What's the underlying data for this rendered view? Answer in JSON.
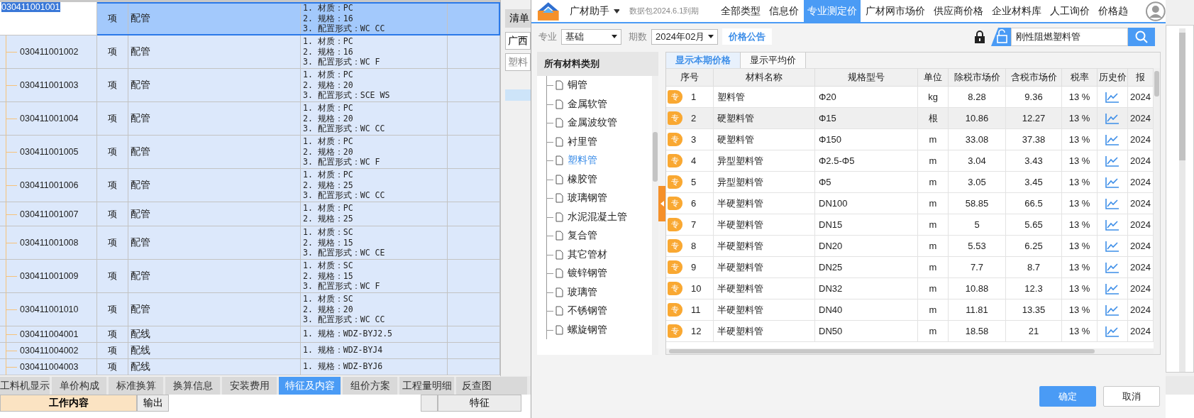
{
  "bill_table": {
    "rows": [
      {
        "code": "030411001001",
        "unit": "项",
        "name": "配管",
        "features": [
          "1. 材质：PC",
          "2. 规格：16",
          "3. 配置形式：WC CC"
        ],
        "selected": true
      },
      {
        "code": "030411001002",
        "unit": "项",
        "name": "配管",
        "features": [
          "1. 材质：PC",
          "2. 规格：16",
          "3. 配置形式：WC F"
        ],
        "selected": false
      },
      {
        "code": "030411001003",
        "unit": "项",
        "name": "配管",
        "features": [
          "1. 材质：PC",
          "2. 规格：20",
          "3. 配置形式：SCE WS"
        ],
        "selected": false
      },
      {
        "code": "030411001004",
        "unit": "项",
        "name": "配管",
        "features": [
          "1. 材质：PC",
          "2. 规格：20",
          "3. 配置形式：WC CC"
        ],
        "selected": false
      },
      {
        "code": "030411001005",
        "unit": "项",
        "name": "配管",
        "features": [
          "1. 材质：PC",
          "2. 规格：20",
          "3. 配置形式：WC F"
        ],
        "selected": false
      },
      {
        "code": "030411001006",
        "unit": "项",
        "name": "配管",
        "features": [
          "1. 材质：PC",
          "2. 规格：25",
          "3. 配置形式：WC CC"
        ],
        "selected": false
      },
      {
        "code": "030411001007",
        "unit": "项",
        "name": "配管",
        "features": [
          "1. 材质：PC",
          "2. 规格：25"
        ],
        "selected": false
      },
      {
        "code": "030411001008",
        "unit": "项",
        "name": "配管",
        "features": [
          "1. 材质：SC",
          "2. 规格：15",
          "3. 配置形式：WC CE"
        ],
        "selected": false
      },
      {
        "code": "030411001009",
        "unit": "项",
        "name": "配管",
        "features": [
          "1. 材质：SC",
          "2. 规格：15",
          "3. 配置形式：WC F"
        ],
        "selected": false
      },
      {
        "code": "030411001010",
        "unit": "项",
        "name": "配管",
        "features": [
          "1. 材质：SC",
          "2. 规格：20",
          "3. 配置形式：WC CC"
        ],
        "selected": false
      },
      {
        "code": "030411004001",
        "unit": "项",
        "name": "配线",
        "features": [
          "1. 规格：WDZ-BYJ2.5"
        ],
        "selected": false
      },
      {
        "code": "030411004002",
        "unit": "项",
        "name": "配线",
        "features": [
          "1. 规格：WDZ-BYJ4"
        ],
        "selected": false
      },
      {
        "code": "030411004003",
        "unit": "项",
        "name": "配线",
        "features": [
          "1. 规格：WDZ-BYJ6"
        ],
        "selected": false
      }
    ]
  },
  "bottom_tabs": [
    {
      "label": "工料机显示",
      "selected": false
    },
    {
      "label": "单价构成",
      "selected": false
    },
    {
      "label": "标准换算",
      "selected": false
    },
    {
      "label": "换算信息",
      "selected": false
    },
    {
      "label": "安装费用",
      "selected": false
    },
    {
      "label": "特征及内容",
      "selected": true
    },
    {
      "label": "组价方案",
      "selected": false
    },
    {
      "label": "工程量明细",
      "selected": false
    },
    {
      "label": "反查图",
      "selected": false
    }
  ],
  "work_content": {
    "columns": [
      "工作内容",
      "输出"
    ]
  },
  "feature_panel": {
    "columns": [
      "特征"
    ]
  },
  "background_dialog": {
    "title": "清单",
    "region_value": "广西",
    "search_value": "塑料"
  },
  "material_dialog": {
    "app_name": "广材助手",
    "package_note": "数据包2024.6.1到期",
    "nav": [
      {
        "label": "全部类型",
        "selected": false
      },
      {
        "label": "信息价",
        "selected": false
      },
      {
        "label": "专业测定价",
        "selected": true
      },
      {
        "label": "广材网市场价",
        "selected": false
      },
      {
        "label": "供应商价格",
        "selected": false
      },
      {
        "label": "企业材料库",
        "selected": false
      },
      {
        "label": "人工询价",
        "selected": false
      },
      {
        "label": "价格趋",
        "selected": false
      }
    ],
    "filters": {
      "specialty_label": "专业",
      "specialty": "基础",
      "period_label": "期数",
      "period": "2024年02月",
      "notice_button": "价格公告",
      "search_value": "刚性阻燃塑料管"
    },
    "categories": {
      "header": "所有材料类别",
      "items": [
        {
          "label": "铜管",
          "selected": false
        },
        {
          "label": "金属软管",
          "selected": false
        },
        {
          "label": "金属波纹管",
          "selected": false
        },
        {
          "label": "衬里管",
          "selected": false
        },
        {
          "label": "塑料管",
          "selected": true
        },
        {
          "label": "橡胶管",
          "selected": false
        },
        {
          "label": "玻璃钢管",
          "selected": false
        },
        {
          "label": "水泥混凝土管",
          "selected": false
        },
        {
          "label": "复合管",
          "selected": false
        },
        {
          "label": "其它管材",
          "selected": false
        },
        {
          "label": "镀锌钢管",
          "selected": false
        },
        {
          "label": "玻璃管",
          "selected": false
        },
        {
          "label": "不锈钢管",
          "selected": false
        },
        {
          "label": "螺旋钢管",
          "selected": false
        }
      ]
    },
    "view_tabs": [
      {
        "label": "显示本期价格",
        "selected": true
      },
      {
        "label": "显示平均价",
        "selected": false
      }
    ],
    "columns": [
      "序号",
      "材料名称",
      "规格型号",
      "单位",
      "除税市场价",
      "含税市场价",
      "税率",
      "历史价",
      "报"
    ],
    "rows": [
      {
        "badge": "专",
        "no": "1",
        "name": "塑料管",
        "spec": "Φ20",
        "unit": "kg",
        "price_ex_tax": "8.28",
        "price_inc_tax": "9.36",
        "tax_rate": "13 %",
        "quote": "2024",
        "selected": false
      },
      {
        "badge": "专",
        "no": "2",
        "name": "硬塑料管",
        "spec": "Φ15",
        "unit": "根",
        "price_ex_tax": "10.86",
        "price_inc_tax": "12.27",
        "tax_rate": "13 %",
        "quote": "2024",
        "selected": true
      },
      {
        "badge": "专",
        "no": "3",
        "name": "硬塑料管",
        "spec": "Φ150",
        "unit": "m",
        "price_ex_tax": "33.08",
        "price_inc_tax": "37.38",
        "tax_rate": "13 %",
        "quote": "2024",
        "selected": false
      },
      {
        "badge": "专",
        "no": "4",
        "name": "异型塑料管",
        "spec": "Φ2.5-Φ5",
        "unit": "m",
        "price_ex_tax": "3.04",
        "price_inc_tax": "3.43",
        "tax_rate": "13 %",
        "quote": "2024",
        "selected": false
      },
      {
        "badge": "专",
        "no": "5",
        "name": "异型塑料管",
        "spec": "Φ5",
        "unit": "m",
        "price_ex_tax": "3.05",
        "price_inc_tax": "3.45",
        "tax_rate": "13 %",
        "quote": "2024",
        "selected": false
      },
      {
        "badge": "专",
        "no": "6",
        "name": "半硬塑料管",
        "spec": "DN100",
        "unit": "m",
        "price_ex_tax": "58.85",
        "price_inc_tax": "66.5",
        "tax_rate": "13 %",
        "quote": "2024",
        "selected": false
      },
      {
        "badge": "专",
        "no": "7",
        "name": "半硬塑料管",
        "spec": "DN15",
        "unit": "m",
        "price_ex_tax": "5",
        "price_inc_tax": "5.65",
        "tax_rate": "13 %",
        "quote": "2024",
        "selected": false
      },
      {
        "badge": "专",
        "no": "8",
        "name": "半硬塑料管",
        "spec": "DN20",
        "unit": "m",
        "price_ex_tax": "5.53",
        "price_inc_tax": "6.25",
        "tax_rate": "13 %",
        "quote": "2024",
        "selected": false
      },
      {
        "badge": "专",
        "no": "9",
        "name": "半硬塑料管",
        "spec": "DN25",
        "unit": "m",
        "price_ex_tax": "7.7",
        "price_inc_tax": "8.7",
        "tax_rate": "13 %",
        "quote": "2024",
        "selected": false
      },
      {
        "badge": "专",
        "no": "10",
        "name": "半硬塑料管",
        "spec": "DN32",
        "unit": "m",
        "price_ex_tax": "10.88",
        "price_inc_tax": "12.3",
        "tax_rate": "13 %",
        "quote": "2024",
        "selected": false
      },
      {
        "badge": "专",
        "no": "11",
        "name": "半硬塑料管",
        "spec": "DN40",
        "unit": "m",
        "price_ex_tax": "11.81",
        "price_inc_tax": "13.35",
        "tax_rate": "13 %",
        "quote": "2024",
        "selected": false
      },
      {
        "badge": "专",
        "no": "12",
        "name": "半硬塑料管",
        "spec": "DN50",
        "unit": "m",
        "price_ex_tax": "18.58",
        "price_inc_tax": "21",
        "tax_rate": "13 %",
        "quote": "2024",
        "selected": false
      }
    ],
    "buttons": [
      {
        "label": "确定",
        "kind": "primary"
      },
      {
        "label": "取消",
        "kind": "secondary"
      }
    ]
  }
}
